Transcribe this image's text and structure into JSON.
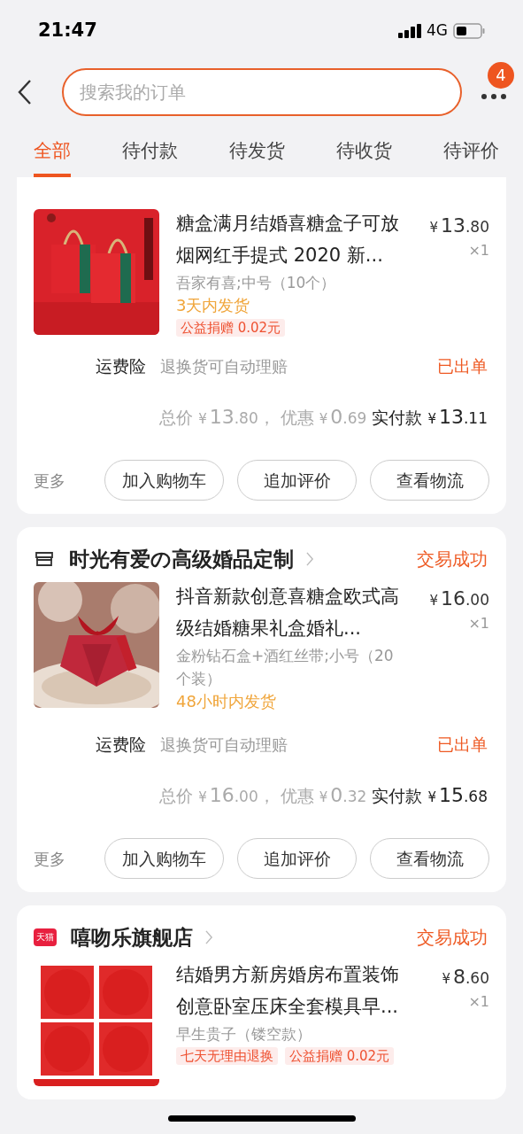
{
  "status_bar": {
    "time": "21:47",
    "network": "4G"
  },
  "search": {
    "placeholder": "搜索我的订单"
  },
  "more_badge": "4",
  "tabs": [
    {
      "label": "全部",
      "selected": true
    },
    {
      "label": "待付款",
      "selected": false
    },
    {
      "label": "待发货",
      "selected": false
    },
    {
      "label": "待收货",
      "selected": false
    },
    {
      "label": "待评价",
      "selected": false
    }
  ],
  "orders": [
    {
      "items": [
        {
          "title": "糖盒满月结婚喜糖盒子可放烟网红手提式 2020 新...",
          "price": {
            "cur": "¥",
            "int": "13",
            "dec": ".80"
          },
          "qty": "×1",
          "spec": "吾家有喜;中号（10个）",
          "tags": [
            {
              "kind": "delivery",
              "text": "3天内发货"
            },
            {
              "kind": "badge",
              "text": "公益捐赠 0.02元"
            }
          ]
        }
      ],
      "insurance": {
        "label": "运费险",
        "desc": "退换货可自动理赔",
        "status": "已出单"
      },
      "totals": {
        "total_label": "总价",
        "total": {
          "cur": "¥",
          "int": "13",
          "dec": ".80"
        },
        "sep": "，",
        "discount_label": "优惠",
        "discount": {
          "cur": "¥",
          "int": "0",
          "dec": ".69"
        },
        "paid_label": "实付款",
        "paid": {
          "cur": "¥",
          "int": "13",
          "dec": ".11"
        }
      },
      "more": "更多",
      "actions": [
        "加入购物车",
        "追加评价",
        "查看物流"
      ]
    },
    {
      "shop": {
        "kind": "store",
        "name": "时光有爱の高级婚品定制"
      },
      "status": "交易成功",
      "items": [
        {
          "title": "抖音新款创意喜糖盒欧式高级结婚糖果礼盒婚礼...",
          "price": {
            "cur": "¥",
            "int": "16",
            "dec": ".00"
          },
          "qty": "×1",
          "spec": "金粉钻石盒+酒红丝带;小号（20个装）",
          "tags": [
            {
              "kind": "delivery",
              "text": "48小时内发货"
            }
          ]
        }
      ],
      "insurance": {
        "label": "运费险",
        "desc": "退换货可自动理赔",
        "status": "已出单"
      },
      "totals": {
        "total_label": "总价",
        "total": {
          "cur": "¥",
          "int": "16",
          "dec": ".00"
        },
        "sep": "，",
        "discount_label": "优惠",
        "discount": {
          "cur": "¥",
          "int": "0",
          "dec": ".32"
        },
        "paid_label": "实付款",
        "paid": {
          "cur": "¥",
          "int": "15",
          "dec": ".68"
        }
      },
      "more": "更多",
      "actions": [
        "加入购物车",
        "追加评价",
        "查看物流"
      ]
    },
    {
      "shop": {
        "kind": "tmall",
        "badge": "天猫",
        "name": "嘻吻乐旗舰店"
      },
      "status": "交易成功",
      "items": [
        {
          "title": "结婚男方新房婚房布置装饰创意卧室压床全套模具早...",
          "price": {
            "cur": "¥",
            "int": "8",
            "dec": ".60"
          },
          "qty": "×1",
          "spec": "早生贵子（镂空款）",
          "tags": [
            {
              "kind": "badge",
              "text": "七天无理由退换"
            },
            {
              "kind": "badge",
              "text": "公益捐赠 0.02元"
            }
          ]
        }
      ]
    }
  ]
}
